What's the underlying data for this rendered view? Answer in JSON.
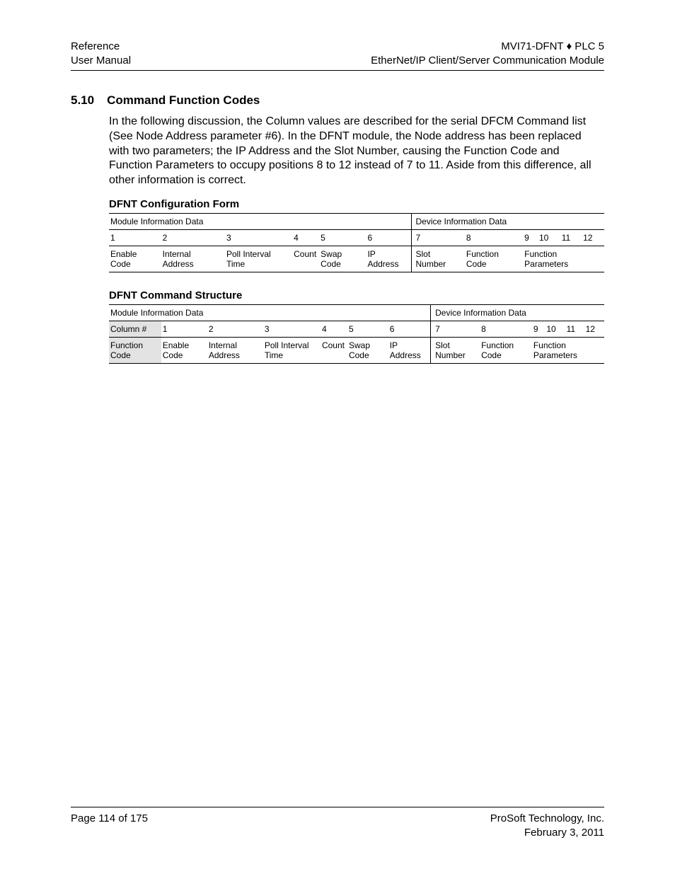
{
  "header": {
    "left_line1": "Reference",
    "left_line2": "User Manual",
    "right_line1_a": "MVI71-DFNT ",
    "right_line1_diamond": "♦",
    "right_line1_b": " PLC 5",
    "right_line2": "EtherNet/IP Client/Server Communication Module"
  },
  "section": {
    "number": "5.10",
    "title": "Command Function Codes",
    "paragraph": "In the following discussion, the Column values are described for the serial DFCM Command list (See Node Address parameter #6). In the DFNT module, the Node address has been replaced with two parameters; the IP Address and the Slot Number, causing the Function Code and Function Parameters to occupy positions 8 to 12 instead of 7 to 11. Aside from this difference, all other information is correct."
  },
  "table1": {
    "title": "DFNT Configuration Form",
    "group_a": "Module Information Data",
    "group_b": "Device Information Data",
    "nums": [
      "1",
      "2",
      "3",
      "4",
      "5",
      "6",
      "7",
      "8",
      "9",
      "10",
      "11",
      "12"
    ],
    "labels": [
      "Enable Code",
      "Internal Address",
      "Poll Interval Time",
      "Count",
      "Swap Code",
      "IP Address",
      "Slot Number",
      "Function Code",
      "Function Parameters"
    ]
  },
  "table2": {
    "title": "DFNT Command Structure",
    "group_a": "Module Information Data",
    "group_b": "Device Information Data",
    "col_label": "Column #",
    "row_label": "Function Code",
    "nums": [
      "1",
      "2",
      "3",
      "4",
      "5",
      "6",
      "7",
      "8",
      "9",
      "10",
      "11",
      "12"
    ],
    "labels": [
      "Enable Code",
      "Internal Address",
      "Poll Interval Time",
      "Count",
      "Swap Code",
      "IP Address",
      "Slot Number",
      "Function Code",
      "Function Parameters"
    ]
  },
  "footer": {
    "left": "Page 114 of 175",
    "right_line1": "ProSoft Technology, Inc.",
    "right_line2": "February 3, 2011"
  }
}
